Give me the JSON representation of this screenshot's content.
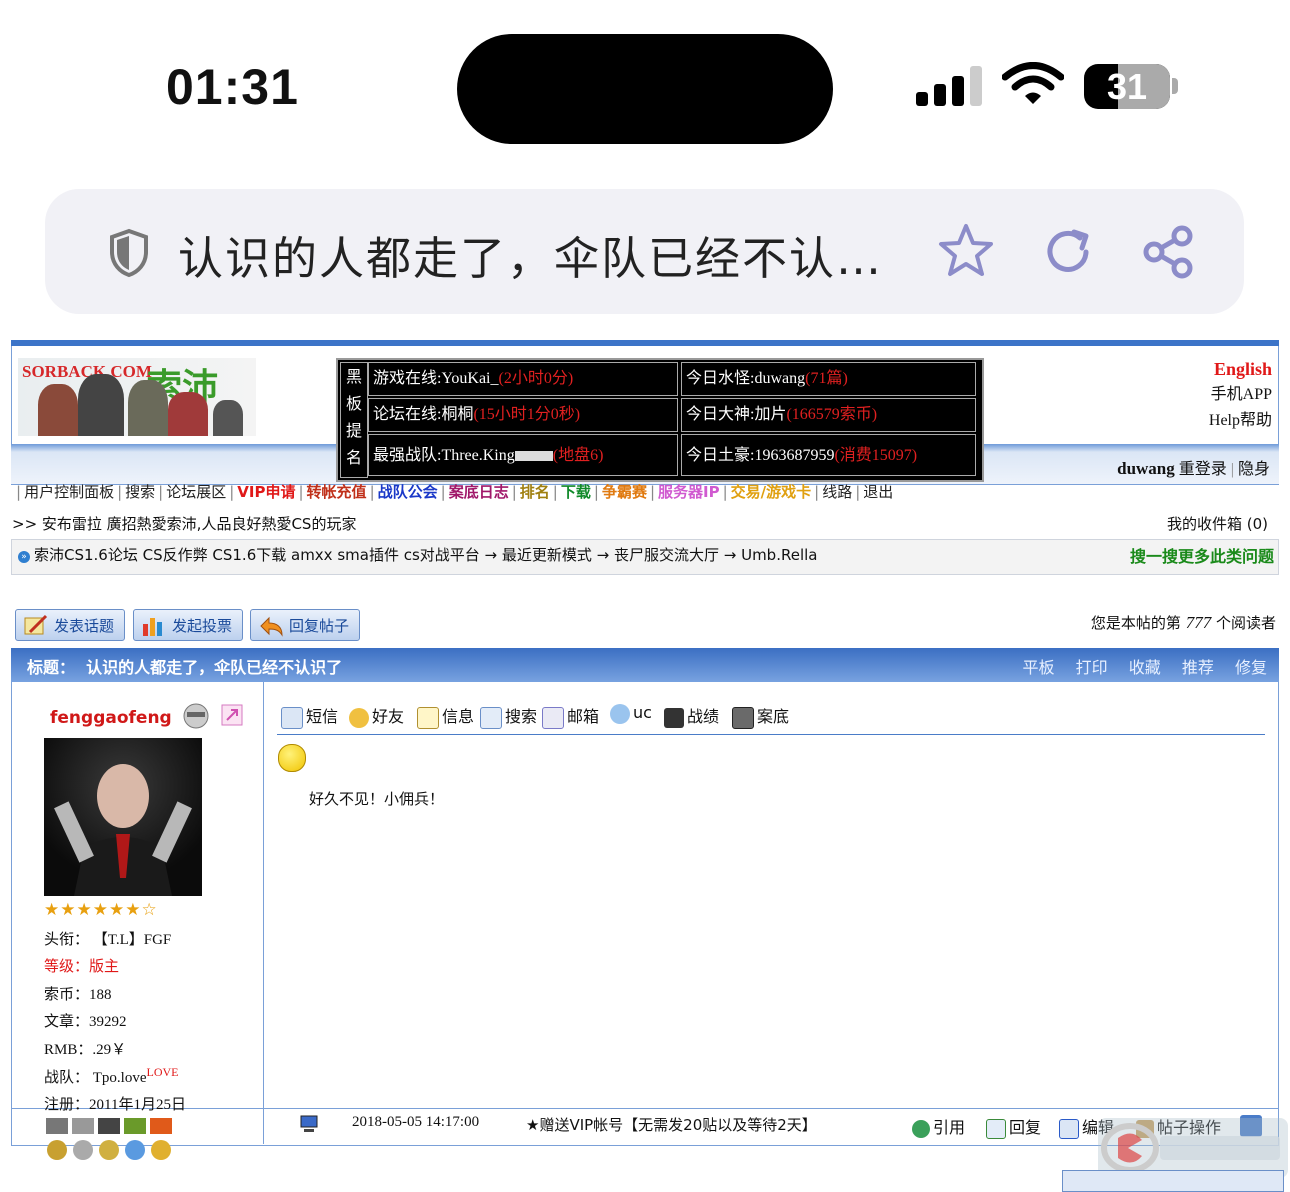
{
  "status": {
    "time": "01:31",
    "battery": "31"
  },
  "browser": {
    "tab_title": "认识的人都走了，伞队已经不认…"
  },
  "header": {
    "logo_text": "SORBACK.COM",
    "logo_cn": "索沛CS",
    "board_label": "黑板提名",
    "board": {
      "r1c1": "游戏在线:YouKai_",
      "r1c1_red": "(2小时0分)",
      "r1c2": "今日水怪:duwang",
      "r1c2_red": "(71篇)",
      "r2c1": "论坛在线:桐桐",
      "r2c1_red": "(15小时1分0秒)",
      "r2c2": "今日大神:加片",
      "r2c2_red": "(166579索币)",
      "r3c1": "最强战队:Three.King",
      "r3c1_red": "(地盘6)",
      "r3c2": "今日土豪:1963687959",
      "r3c2_red": "(消费15097)"
    },
    "english": "English",
    "mobile_app": "手机APP",
    "help": "Help帮助",
    "user": "duwang",
    "relogin": "重登录",
    "hide": "隐身"
  },
  "nav": [
    {
      "label": "用户控制面板",
      "color": "#222"
    },
    {
      "label": "搜索",
      "color": "#222"
    },
    {
      "label": "论坛展区",
      "color": "#222"
    },
    {
      "label": "VIP申请",
      "color": "#e01818"
    },
    {
      "label": "转帐充值",
      "color": "#c0301a"
    },
    {
      "label": "战队公会",
      "color": "#1a38c8"
    },
    {
      "label": "案底日志",
      "color": "#a0186a"
    },
    {
      "label": "排名",
      "color": "#a08010"
    },
    {
      "label": "下载",
      "color": "#118a2a"
    },
    {
      "label": "争霸赛",
      "color": "#e07a10"
    },
    {
      "label": "服务器IP",
      "color": "#d05ad0"
    },
    {
      "label": "交易/游戏卡",
      "color": "#e0a010"
    },
    {
      "label": "线路",
      "color": "#222"
    },
    {
      "label": "退出",
      "color": "#222"
    }
  ],
  "announcement": ">> 安布雷拉 廣招熱愛索沛,人品良好熱愛CS的玩家",
  "inbox": "我的收件箱 (0)",
  "breadcrumb": "索沛CS1.6论坛 CS反作弊 CS1.6下载 amxx sma插件 cs对战平台 → 最近更新模式 → 丧尸服交流大厅 → Umb.Rella",
  "search_more": "搜一搜更多此类问题",
  "buttons": {
    "new_topic": "发表话题",
    "new_poll": "发起投票",
    "reply": "回复帖子"
  },
  "reader": {
    "prefix": "您是本帖的第",
    "count": "777",
    "suffix": "个阅读者"
  },
  "title_bar": {
    "label": "标题：",
    "title": "认识的人都走了，伞队已经不认识了",
    "tools": [
      "平板",
      "打印",
      "收藏",
      "推荐",
      "修复"
    ]
  },
  "author": {
    "name": "fenggaofeng",
    "stars": "★★★★★★☆",
    "title_label": "头衔：",
    "title_value": "【T.L】FGF",
    "level_label": "等级：",
    "level_value": "版主",
    "coins_label": "索币：",
    "coins": "188",
    "posts_label": "文章：",
    "posts": "39292",
    "rmb_label": "RMB：",
    "rmb": ".29￥",
    "team_label": "战队：",
    "team": "Tpo.love",
    "team_sup": "LOVE",
    "reg_label": "注册：",
    "reg": "2011年1月25日"
  },
  "post_tools": [
    "短信",
    "好友",
    "信息",
    "搜索",
    "邮箱",
    "uc",
    "战绩",
    "案底"
  ],
  "post_content": "好久不见！小佣兵！",
  "footer": {
    "date": "2018-05-05 14:17:00",
    "vip": "★赠送VIP帐号【无需发20贴以及等待2天】",
    "actions": [
      "引用",
      "回复",
      "编辑",
      "帖子操作"
    ]
  },
  "colors": {
    "accent": "#3c74c8",
    "red": "#e02020",
    "green": "#1a8a1a"
  }
}
